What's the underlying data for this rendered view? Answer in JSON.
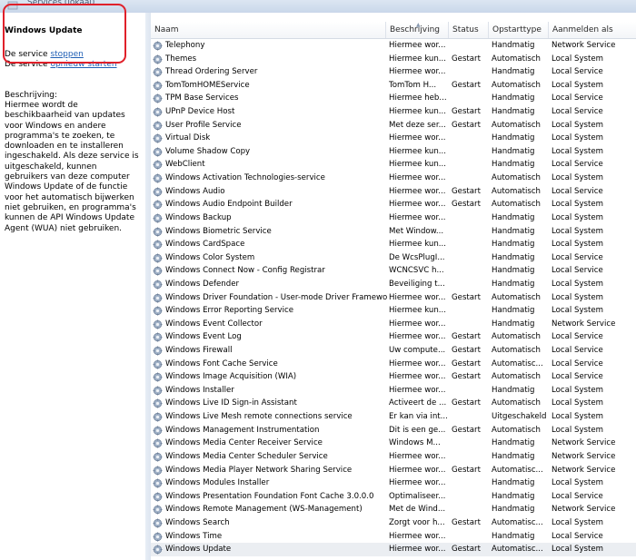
{
  "window": {
    "title": "Services (lokaal)"
  },
  "left_pane": {
    "service_title": "Windows Update",
    "action_stop_prefix": "De service ",
    "action_stop_link": "stoppen",
    "action_restart_prefix": "De service ",
    "action_restart_link": "opnieuw starten",
    "description_label": "Beschrijving:",
    "description": "Hiermee wordt de beschikbaarheid van updates voor Windows en andere programma's te zoeken, te downloaden en te installeren ingeschakeld. Als deze service is uitgeschakeld, kunnen gebruikers van deze computer Windows Update of de functie voor het automatisch bijwerken niet gebruiken, en programma's kunnen de API Windows Update Agent (WUA) niet gebruiken."
  },
  "columns": {
    "name": "Naam",
    "description": "Beschrijving",
    "status": "Status",
    "startup_type": "Opstarttype",
    "log_on_as": "Aanmelden als"
  },
  "rows": [
    {
      "name": "Telephony",
      "desc": "Hiermee wor...",
      "status": "",
      "type": "Handmatig",
      "logon": "Network Service"
    },
    {
      "name": "Themes",
      "desc": "Hiermee kun...",
      "status": "Gestart",
      "type": "Automatisch",
      "logon": "Local System"
    },
    {
      "name": "Thread Ordering Server",
      "desc": "Hiermee wor...",
      "status": "",
      "type": "Handmatig",
      "logon": "Local Service"
    },
    {
      "name": "TomTomHOMEService",
      "desc": "TomTom H...",
      "status": "Gestart",
      "type": "Automatisch",
      "logon": "Local System"
    },
    {
      "name": "TPM Base Services",
      "desc": "Hiermee heb...",
      "status": "",
      "type": "Handmatig",
      "logon": "Local Service"
    },
    {
      "name": "UPnP Device Host",
      "desc": "Hiermee kun...",
      "status": "Gestart",
      "type": "Handmatig",
      "logon": "Local Service"
    },
    {
      "name": "User Profile Service",
      "desc": "Met deze ser...",
      "status": "Gestart",
      "type": "Automatisch",
      "logon": "Local System"
    },
    {
      "name": "Virtual Disk",
      "desc": "Hiermee wor...",
      "status": "",
      "type": "Handmatig",
      "logon": "Local System"
    },
    {
      "name": "Volume Shadow Copy",
      "desc": "Hiermee kun...",
      "status": "",
      "type": "Handmatig",
      "logon": "Local System"
    },
    {
      "name": "WebClient",
      "desc": "Hiermee kun...",
      "status": "",
      "type": "Handmatig",
      "logon": "Local Service"
    },
    {
      "name": "Windows Activation Technologies-service",
      "desc": "Hiermee wor...",
      "status": "",
      "type": "Automatisch",
      "logon": "Local System"
    },
    {
      "name": "Windows Audio",
      "desc": "Hiermee wor...",
      "status": "Gestart",
      "type": "Automatisch",
      "logon": "Local Service"
    },
    {
      "name": "Windows Audio Endpoint Builder",
      "desc": "Hiermee wor...",
      "status": "Gestart",
      "type": "Automatisch",
      "logon": "Local System"
    },
    {
      "name": "Windows Backup",
      "desc": "Hiermee wor...",
      "status": "",
      "type": "Handmatig",
      "logon": "Local System"
    },
    {
      "name": "Windows Biometric Service",
      "desc": "Met Window...",
      "status": "",
      "type": "Handmatig",
      "logon": "Local System"
    },
    {
      "name": "Windows CardSpace",
      "desc": "Hiermee kun...",
      "status": "",
      "type": "Handmatig",
      "logon": "Local System"
    },
    {
      "name": "Windows Color System",
      "desc": "De WcsPlugI...",
      "status": "",
      "type": "Handmatig",
      "logon": "Local Service"
    },
    {
      "name": "Windows Connect Now - Config Registrar",
      "desc": "WCNCSVC h...",
      "status": "",
      "type": "Handmatig",
      "logon": "Local Service"
    },
    {
      "name": "Windows Defender",
      "desc": "Beveiliging t...",
      "status": "",
      "type": "Handmatig",
      "logon": "Local System"
    },
    {
      "name": "Windows Driver Foundation - User-mode Driver Framework",
      "desc": "Hiermee wor...",
      "status": "Gestart",
      "type": "Automatisch",
      "logon": "Local System"
    },
    {
      "name": "Windows Error Reporting Service",
      "desc": "Hiermee kun...",
      "status": "",
      "type": "Handmatig",
      "logon": "Local System"
    },
    {
      "name": "Windows Event Collector",
      "desc": "Hiermee wor...",
      "status": "",
      "type": "Handmatig",
      "logon": "Network Service"
    },
    {
      "name": "Windows Event Log",
      "desc": "Hiermee wor...",
      "status": "Gestart",
      "type": "Automatisch",
      "logon": "Local Service"
    },
    {
      "name": "Windows Firewall",
      "desc": "Uw compute...",
      "status": "Gestart",
      "type": "Automatisch",
      "logon": "Local Service"
    },
    {
      "name": "Windows Font Cache Service",
      "desc": "Hiermee wor...",
      "status": "Gestart",
      "type": "Automatisc...",
      "logon": "Local Service"
    },
    {
      "name": "Windows Image Acquisition (WIA)",
      "desc": "Hiermee wor...",
      "status": "Gestart",
      "type": "Automatisch",
      "logon": "Local Service"
    },
    {
      "name": "Windows Installer",
      "desc": "Hiermee wor...",
      "status": "",
      "type": "Handmatig",
      "logon": "Local System"
    },
    {
      "name": "Windows Live ID Sign-in Assistant",
      "desc": "Activeert de ...",
      "status": "Gestart",
      "type": "Automatisch",
      "logon": "Local System"
    },
    {
      "name": "Windows Live Mesh remote connections service",
      "desc": "Er kan via int...",
      "status": "",
      "type": "Uitgeschakeld",
      "logon": "Local System"
    },
    {
      "name": "Windows Management Instrumentation",
      "desc": "Dit is een ge...",
      "status": "Gestart",
      "type": "Automatisch",
      "logon": "Local System"
    },
    {
      "name": "Windows Media Center Receiver Service",
      "desc": "Windows M...",
      "status": "",
      "type": "Handmatig",
      "logon": "Network Service"
    },
    {
      "name": "Windows Media Center Scheduler Service",
      "desc": "Hiermee wor...",
      "status": "",
      "type": "Handmatig",
      "logon": "Network Service"
    },
    {
      "name": "Windows Media Player Network Sharing Service",
      "desc": "Hiermee wor...",
      "status": "Gestart",
      "type": "Automatisc...",
      "logon": "Network Service"
    },
    {
      "name": "Windows Modules Installer",
      "desc": "Hiermee wor...",
      "status": "",
      "type": "Handmatig",
      "logon": "Local System"
    },
    {
      "name": "Windows Presentation Foundation Font Cache 3.0.0.0",
      "desc": "Optimaliseer...",
      "status": "",
      "type": "Handmatig",
      "logon": "Local Service"
    },
    {
      "name": "Windows Remote Management (WS-Management)",
      "desc": "Met de Wind...",
      "status": "",
      "type": "Handmatig",
      "logon": "Network Service"
    },
    {
      "name": "Windows Search",
      "desc": "Zorgt voor h...",
      "status": "Gestart",
      "type": "Automatisc...",
      "logon": "Local System"
    },
    {
      "name": "Windows Time",
      "desc": "Hiermee wor...",
      "status": "",
      "type": "Handmatig",
      "logon": "Local Service"
    },
    {
      "name": "Windows Update",
      "desc": "Hiermee wor...",
      "status": "Gestart",
      "type": "Automatisc...",
      "logon": "Local System",
      "selected": true
    }
  ],
  "colors": {
    "highlight": "#e0202a",
    "link": "#1f5fb5",
    "selected_row": "#ebeef2"
  }
}
